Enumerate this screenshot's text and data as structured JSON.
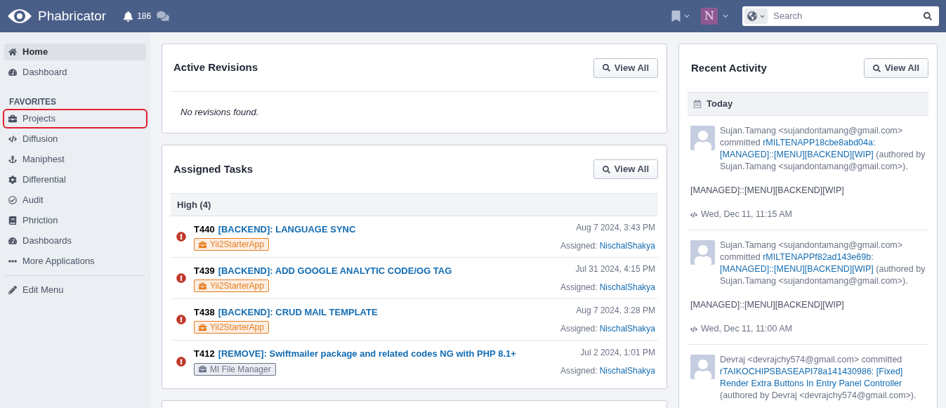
{
  "header": {
    "brand": "Phabricator",
    "notifications": "186",
    "profile_initial": "N",
    "search": {
      "placeholder": "Search"
    }
  },
  "sidebar": {
    "items": [
      {
        "label": "Home",
        "selected": true,
        "highlighted": false
      },
      {
        "label": "Dashboard",
        "selected": false,
        "highlighted": false
      }
    ],
    "section": "FAVORITES",
    "favorites": [
      {
        "label": "Projects",
        "selected": false,
        "highlighted": true
      },
      {
        "label": "Diffusion",
        "selected": false,
        "highlighted": false
      },
      {
        "label": "Maniphest",
        "selected": false,
        "highlighted": false
      },
      {
        "label": "Differential",
        "selected": false,
        "highlighted": false
      },
      {
        "label": "Audit",
        "selected": false,
        "highlighted": false
      },
      {
        "label": "Phriction",
        "selected": false,
        "highlighted": false
      },
      {
        "label": "Dashboards",
        "selected": false,
        "highlighted": false
      },
      {
        "label": "More Applications",
        "selected": false,
        "highlighted": false
      }
    ],
    "footer": "Edit Menu"
  },
  "revisions": {
    "title": "Active Revisions",
    "button": "View All",
    "empty": "No revisions found."
  },
  "tasks": {
    "title": "Assigned Tasks",
    "button": "View All",
    "group": "High (4)",
    "rows": [
      {
        "id": "T440",
        "title": "[BACKEND]: LANGUAGE SYNC",
        "tag": "Yii2StarterApp",
        "color": "#e67e22",
        "date": "Aug 7 2024, 3:43 PM",
        "assigned_label": "Assigned:",
        "assignee": "NischalShakya"
      },
      {
        "id": "T439",
        "title": "[BACKEND]: ADD GOOGLE ANALYTIC CODE/OG TAG",
        "tag": "Yii2StarterApp",
        "color": "#e67e22",
        "date": "Jul 31 2024, 4:15 PM",
        "assigned_label": "Assigned:",
        "assignee": "NischalShakya"
      },
      {
        "id": "T438",
        "title": "[BACKEND]: CRUD MAIL TEMPLATE",
        "tag": "Yii2StarterApp",
        "color": "#e67e22",
        "date": "Aug 7 2024, 3:28 PM",
        "assigned_label": "Assigned:",
        "assignee": "NischalShakya"
      },
      {
        "id": "T412",
        "title": "[REMOVE]: Swiftmailer package and related codes NG with PHP 8.1+",
        "tag": "MI File Manager",
        "color": "#6b748c",
        "date": "Jul 2 2024, 1:01 PM",
        "assigned_label": "Assigned:",
        "assignee": "NischalShakya"
      }
    ]
  },
  "activity": {
    "title": "Recent Activity",
    "button": "View All",
    "day": "Today",
    "entries": [
      {
        "parts": [
          {
            "kind": "text",
            "text": "Sujan.Tamang <sujandontamang@gmail.com> committed"
          },
          {
            "kind": "link",
            "text": "rMILTENAPP18cbe8abd04a:"
          },
          {
            "kind": "link",
            "text": "[MANAGED]::[MENU][BACKEND][WIP]"
          },
          {
            "kind": "text",
            "text": "(authored by Sujan.Tamang <sujandontamang@gmail.com>)."
          }
        ],
        "message": "[MANAGED]::[MENU][BACKEND][WIP]",
        "time": "Wed, Dec 11, 11:15 AM"
      },
      {
        "parts": [
          {
            "kind": "text",
            "text": "Sujan.Tamang <sujandontamang@gmail.com> committed"
          },
          {
            "kind": "link",
            "text": "rMILTENAPPf82ad143e69b:"
          },
          {
            "kind": "link",
            "text": "[MANAGED]::[MENU][BACKEND][WIP]"
          },
          {
            "kind": "text",
            "text": "(authored by Sujan.Tamang <sujandontamang@gmail.com>)."
          }
        ],
        "message": "[MANAGED]::[MENU][BACKEND][WIP]",
        "time": "Wed, Dec 11, 11:00 AM"
      },
      {
        "parts": [
          {
            "kind": "text",
            "text": "Devraj <devrajchy574@gmail.com> committed"
          },
          {
            "kind": "link",
            "text": "rTAIKOCHIPSBASEAPI78a141430986: [Fixed]"
          },
          {
            "kind": "link",
            "text": "Render Extra Buttons In Entry Panel Controller"
          },
          {
            "kind": "text",
            "text": "(authored by Devraj <devrajchy574@gmail.com>)."
          }
        ]
      }
    ]
  }
}
